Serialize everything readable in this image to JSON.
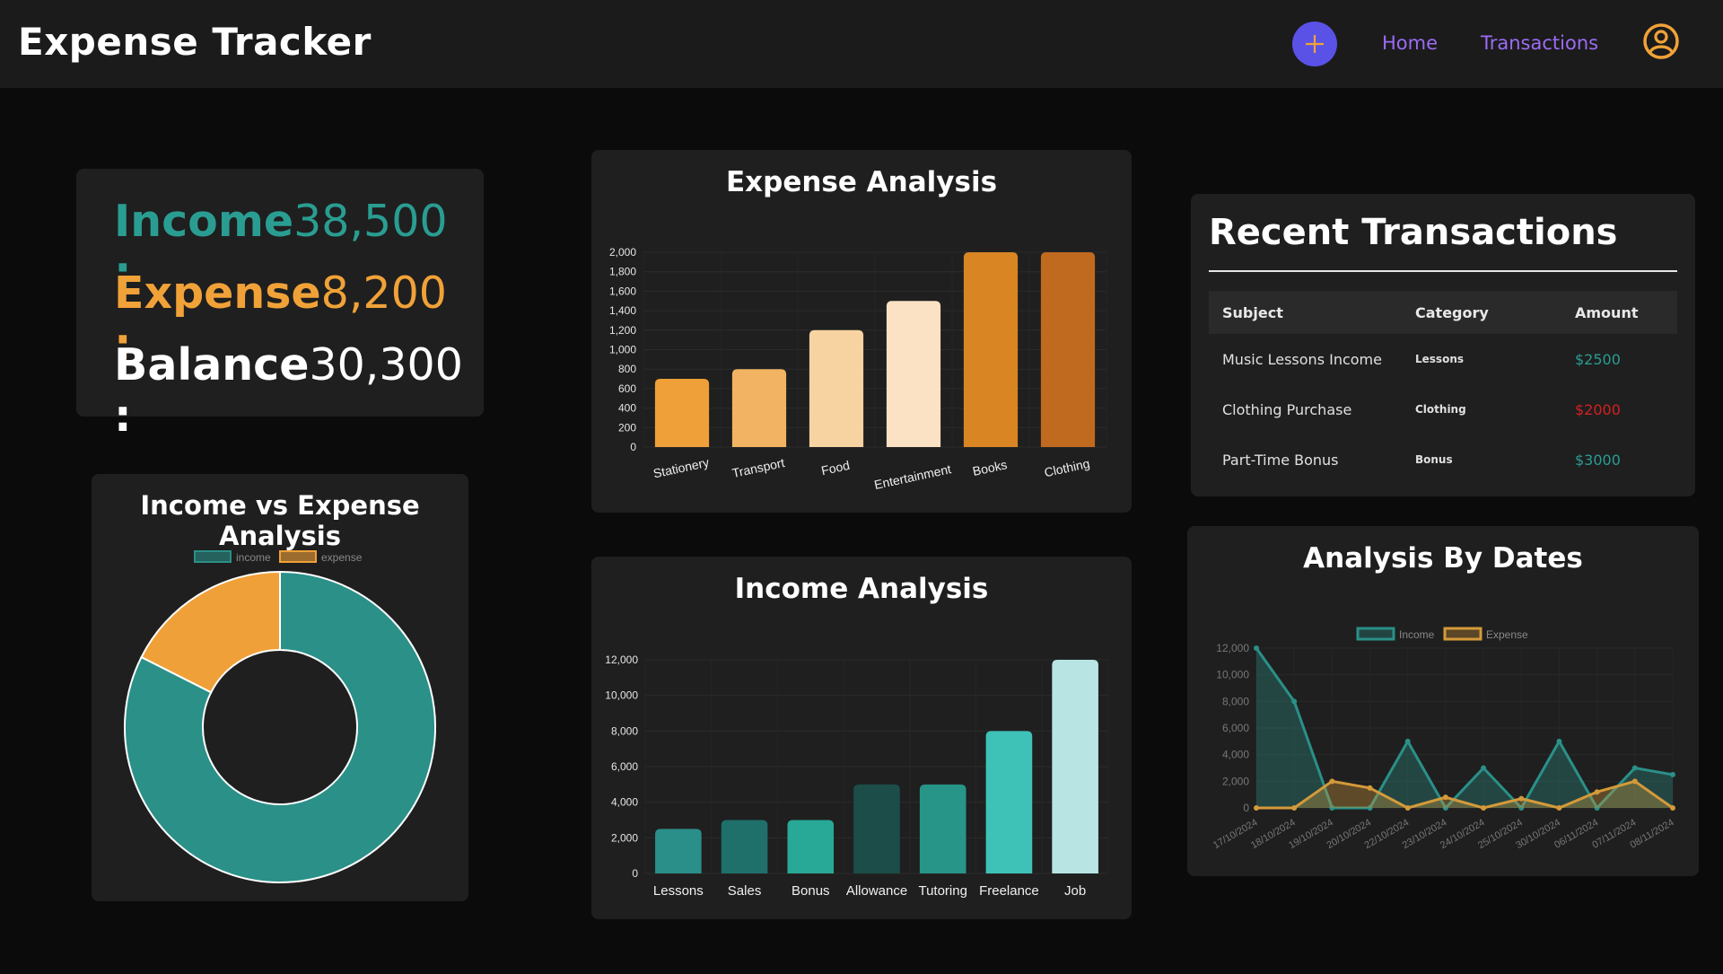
{
  "navbar": {
    "brand": "Expense Tracker",
    "add_icon": "plus-icon",
    "links": [
      {
        "label": "Home"
      },
      {
        "label": "Transactions"
      }
    ],
    "profile_icon": "user-circle-icon",
    "accent": "#9b6cf4"
  },
  "summary": {
    "income_label": "Income :",
    "income_value": "38,500",
    "expense_label": "Expense :",
    "expense_value": "8,200",
    "balance_label": "Balance :",
    "balance_value": "30,300"
  },
  "donut": {
    "title": "Income vs Expense Analysis",
    "chart_data": {
      "type": "pie",
      "series": [
        {
          "name": "income",
          "value": 38500,
          "color": "#2a9088"
        },
        {
          "name": "expense",
          "value": 8200,
          "color": "#f0a038"
        }
      ],
      "legend": "top"
    }
  },
  "expense_analysis": {
    "title": "Expense Analysis",
    "chart_data": {
      "type": "bar",
      "categories": [
        "Stationery",
        "Transport",
        "Food",
        "Entertainment",
        "Books",
        "Clothing"
      ],
      "values": [
        700,
        800,
        1200,
        1500,
        2000,
        2000
      ],
      "colors": [
        "#f0a038",
        "#f2b462",
        "#f7d3a1",
        "#fbe2c4",
        "#d98523",
        "#c06a20"
      ],
      "ylim": [
        0,
        2000
      ],
      "yticks": [
        "0",
        "200",
        "400",
        "600",
        "800",
        "1,000",
        "1,200",
        "1,400",
        "1,600",
        "1,800",
        "2,000"
      ]
    }
  },
  "income_analysis": {
    "title": "Income Analysis",
    "chart_data": {
      "type": "bar",
      "categories": [
        "Lessons",
        "Sales",
        "Bonus",
        "Allowance",
        "Tutoring",
        "Freelance",
        "Job"
      ],
      "values": [
        2500,
        3000,
        3000,
        5000,
        5000,
        8000,
        12000
      ],
      "colors": [
        "#2a8e89",
        "#1f6f6a",
        "#28a896",
        "#1c4d48",
        "#279588",
        "#3ec2b8",
        "#b8e5e4"
      ],
      "ylim": [
        0,
        12000
      ],
      "yticks": [
        "0",
        "2,000",
        "4,000",
        "6,000",
        "8,000",
        "10,000",
        "12,000"
      ]
    }
  },
  "recent": {
    "title": "Recent Transactions",
    "headers": [
      "Subject",
      "Category",
      "Amount"
    ],
    "rows": [
      {
        "subject": "Music Lessons Income",
        "category": "Lessons",
        "amount": "$2500",
        "type": "income"
      },
      {
        "subject": "Clothing Purchase",
        "category": "Clothing",
        "amount": "$2000",
        "type": "expense"
      },
      {
        "subject": "Part-Time Bonus",
        "category": "Bonus",
        "amount": "$3000",
        "type": "income"
      }
    ]
  },
  "dates_analysis": {
    "title": "Analysis By Dates",
    "chart_data": {
      "type": "area",
      "x": [
        "17/10/2024",
        "18/10/2024",
        "19/10/2024",
        "20/10/2024",
        "22/10/2024",
        "23/10/2024",
        "24/10/2024",
        "25/10/2024",
        "30/10/2024",
        "06/11/2024",
        "07/11/2024",
        "08/11/2024"
      ],
      "series": [
        {
          "name": "Income",
          "color": "#2a9088",
          "values": [
            12000,
            8000,
            0,
            0,
            5000,
            0,
            3000,
            0,
            5000,
            0,
            3000,
            2500
          ]
        },
        {
          "name": "Expense",
          "color": "#d49a3a",
          "values": [
            0,
            0,
            2000,
            1500,
            0,
            800,
            0,
            700,
            0,
            1200,
            2000,
            0
          ]
        }
      ],
      "ylim": [
        0,
        12000
      ],
      "yticks": [
        "0",
        "2,000",
        "4,000",
        "6,000",
        "8,000",
        "10,000",
        "12,000"
      ],
      "legend": "top"
    }
  }
}
